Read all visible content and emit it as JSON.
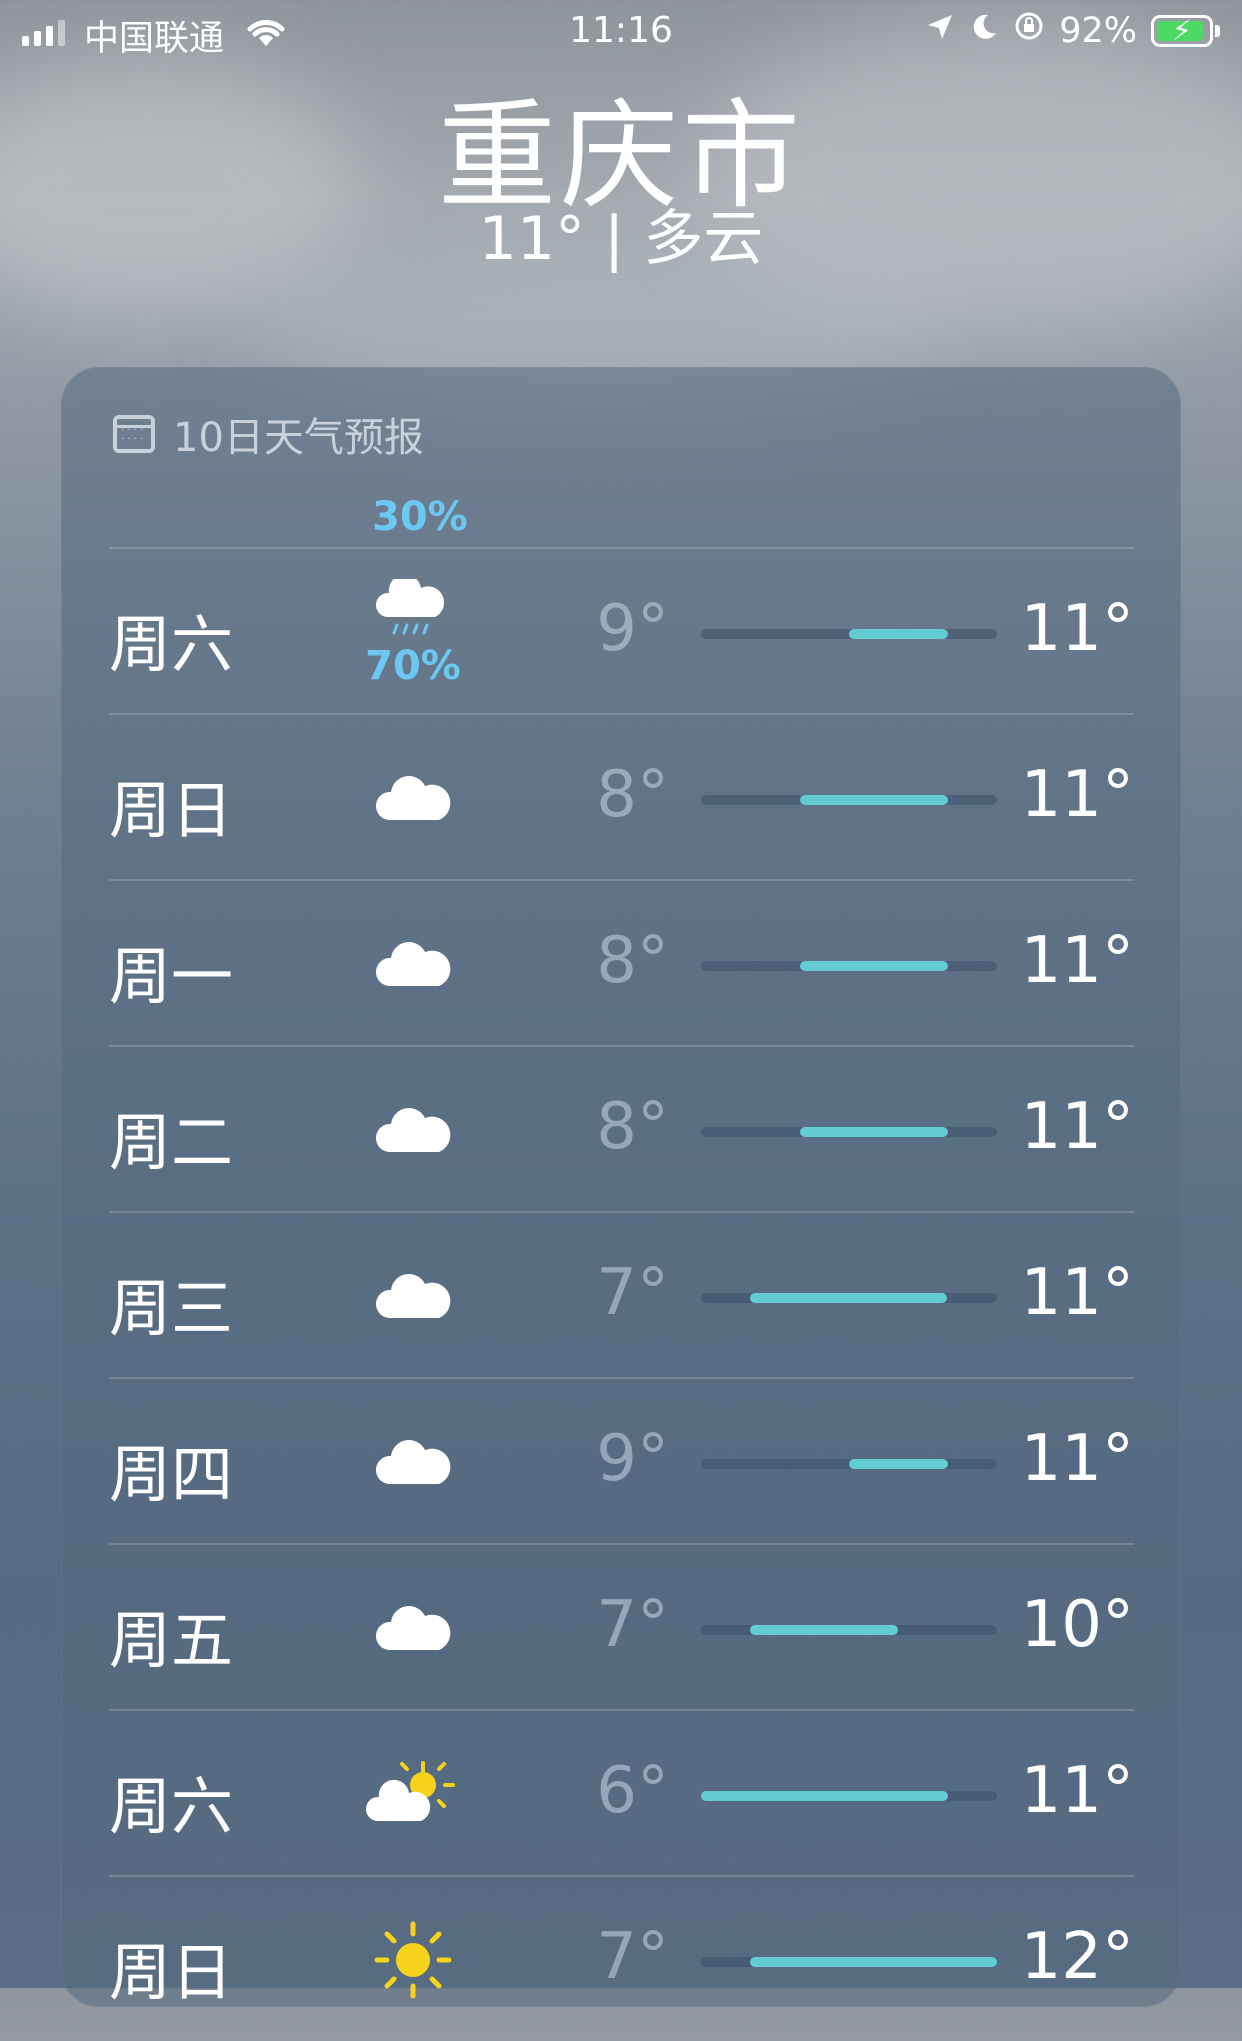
{
  "status_bar": {
    "carrier": "中国联通",
    "time": "11:16",
    "battery": "92%"
  },
  "location": {
    "city": "重庆市",
    "summary": "11° | 多云"
  },
  "forecast": {
    "title": "10日天气预报",
    "partial_row": {
      "precip": "30%"
    },
    "days": [
      {
        "day": "周六",
        "icon": "cloud-rain-icon",
        "precip": "70%",
        "low": "9°",
        "high": "11°",
        "range": [
          9,
          11
        ]
      },
      {
        "day": "周日",
        "icon": "cloud-icon",
        "precip": "",
        "low": "8°",
        "high": "11°",
        "range": [
          8,
          11
        ]
      },
      {
        "day": "周一",
        "icon": "cloud-icon",
        "precip": "",
        "low": "8°",
        "high": "11°",
        "range": [
          8,
          11
        ]
      },
      {
        "day": "周二",
        "icon": "cloud-icon",
        "precip": "",
        "low": "8°",
        "high": "11°",
        "range": [
          8,
          11
        ]
      },
      {
        "day": "周三",
        "icon": "cloud-icon",
        "precip": "",
        "low": "7°",
        "high": "11°",
        "range": [
          7,
          11
        ]
      },
      {
        "day": "周四",
        "icon": "cloud-icon",
        "precip": "",
        "low": "9°",
        "high": "11°",
        "range": [
          9,
          11
        ]
      },
      {
        "day": "周五",
        "icon": "cloud-icon",
        "precip": "",
        "low": "7°",
        "high": "10°",
        "range": [
          7,
          10
        ]
      },
      {
        "day": "周六",
        "icon": "partly-sunny-icon",
        "precip": "",
        "low": "6°",
        "high": "11°",
        "range": [
          6,
          11
        ]
      },
      {
        "day": "周日",
        "icon": "sun-icon",
        "precip": "",
        "low": "7°",
        "high": "12°",
        "range": [
          7,
          12
        ]
      }
    ],
    "scale": {
      "min": 6,
      "max": 12
    },
    "colors": {
      "bar": "#62ccd2",
      "precip": "#6bc8f2"
    }
  }
}
